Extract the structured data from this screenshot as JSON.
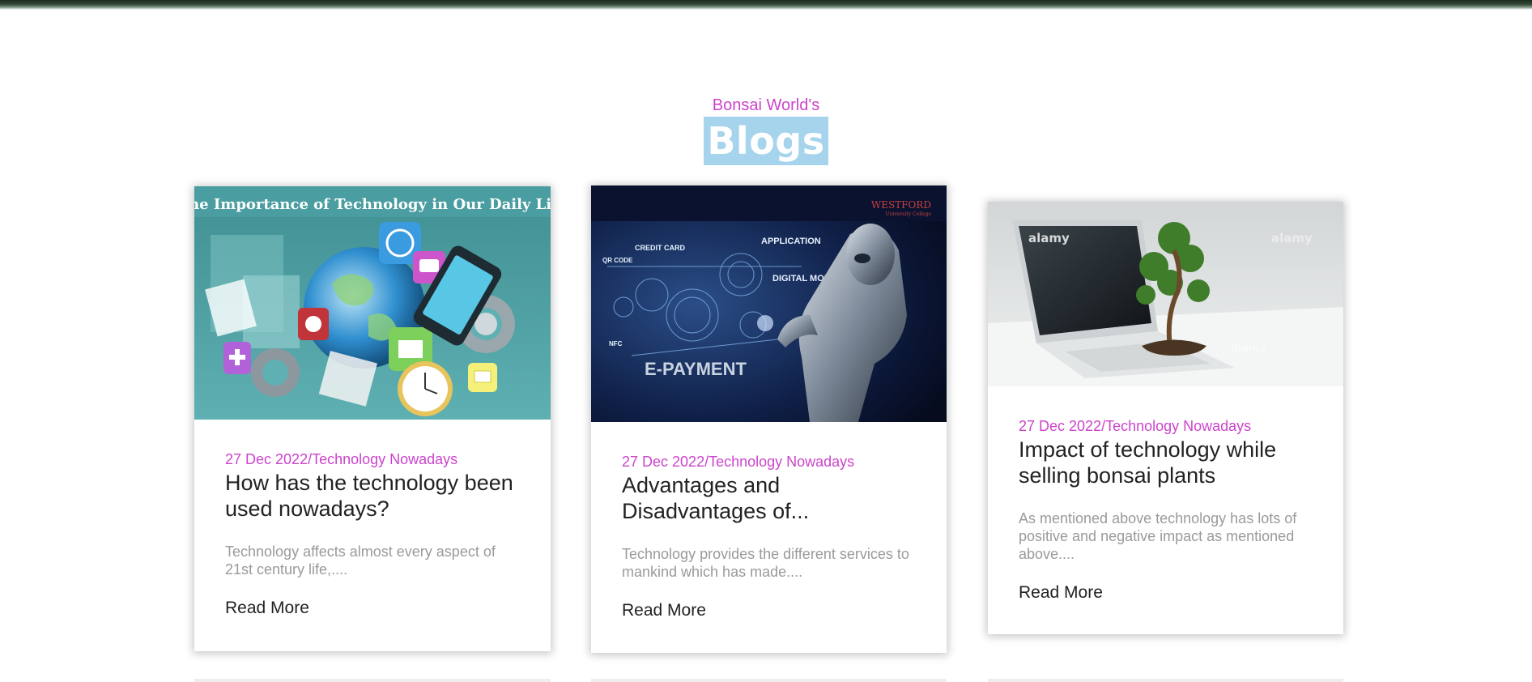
{
  "header": {
    "subtitle": "Bonsai World's",
    "title": "Blogs"
  },
  "posts": [
    {
      "image_caption": "The Importance of Technology in Our Daily Life",
      "meta": "27 Dec 2022/Technology Nowadays",
      "title": "How has the technology been used nowadays?",
      "excerpt": "Technology affects almost every aspect of 21st century life,....",
      "read_more": "Read More"
    },
    {
      "image_brand": "WESTFORD",
      "image_brand_sub": "University College",
      "image_labels": [
        "CREDIT CARD",
        "QR CODE",
        "APPLICATION",
        "DIGITAL MONEY",
        "NFC",
        "E-PAYMENT"
      ],
      "meta": "27 Dec 2022/Technology Nowadays",
      "title": "Advantages and Disadvantages of...",
      "excerpt": "Technology provides the different services to mankind which has made....",
      "read_more": "Read More"
    },
    {
      "image_watermark": "alamy",
      "meta": "27 Dec 2022/Technology Nowadays",
      "title": "Impact of technology while selling bonsai plants",
      "excerpt": "As mentioned above technology has lots of positive and negative impact as mentioned above....",
      "read_more": "Read More"
    }
  ]
}
